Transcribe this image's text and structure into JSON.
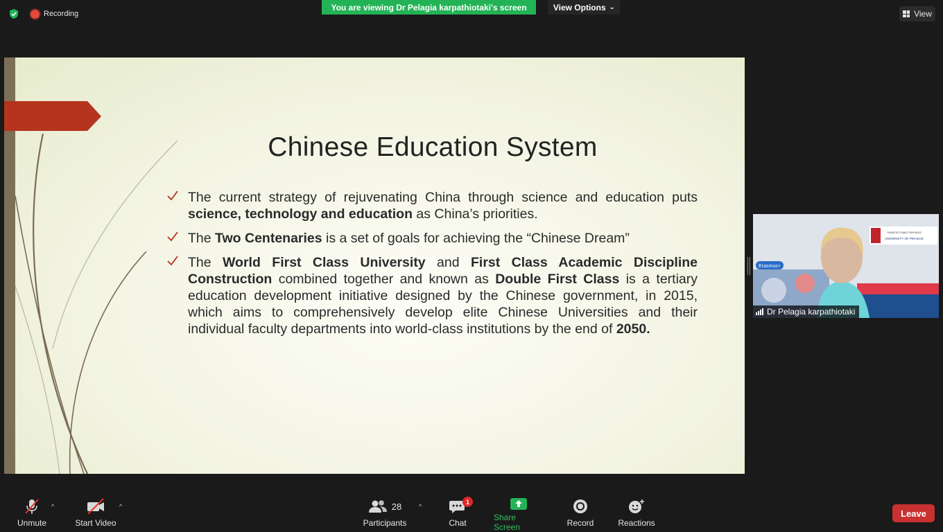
{
  "top": {
    "recording_label": "Recording",
    "viewing_banner": "You are viewing Dr Pelagia karpathiotaki's screen",
    "view_options_label": "View Options",
    "view_label": "View"
  },
  "slide": {
    "title": "Chinese Education System",
    "accent_color": "#b5341d",
    "stripe_color": "#7d7058"
  },
  "participant": {
    "name": "Dr Pelagia karpathiotaki",
    "banner_left": "Erasmus+",
    "logo_top": "ΠΑΝΕΠΙΣΤΗΜΙΟ ΠΕΙΡΑΙΩΣ",
    "logo_bottom": "UNIVERSITY OF PIRAEUS"
  },
  "toolbar": {
    "unmute_label": "Unmute",
    "start_video_label": "Start Video",
    "participants_label": "Participants",
    "participants_count": "28",
    "chat_label": "Chat",
    "chat_badge": "1",
    "share_label": "Share Screen",
    "record_label": "Record",
    "reactions_label": "Reactions",
    "leave_label": "Leave",
    "share_color": "#23b356",
    "leave_color": "#c8312f"
  }
}
